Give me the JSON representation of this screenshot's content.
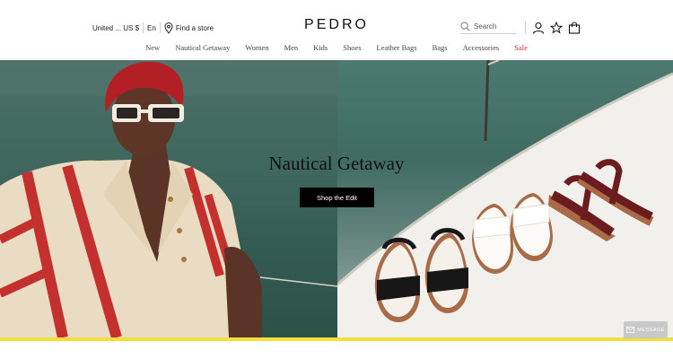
{
  "header": {
    "region": "United ...",
    "currency": "US $",
    "language": "En",
    "find_store": "Find a store",
    "logo": "PEDRO",
    "search_placeholder": "Search"
  },
  "nav": {
    "items": [
      "New",
      "Nautical Getaway",
      "Women",
      "Men",
      "Kids",
      "Shoes",
      "Leather Bags",
      "Bags",
      "Accessories",
      "Sale"
    ]
  },
  "hero": {
    "title": "Nautical Getaway",
    "cta_label": "Shop the Edit"
  },
  "chat": {
    "label": "MESSAGE"
  },
  "colors": {
    "sale": "#c8302c",
    "promo_bar": "#f3de3a",
    "cta_bg": "#000000"
  }
}
